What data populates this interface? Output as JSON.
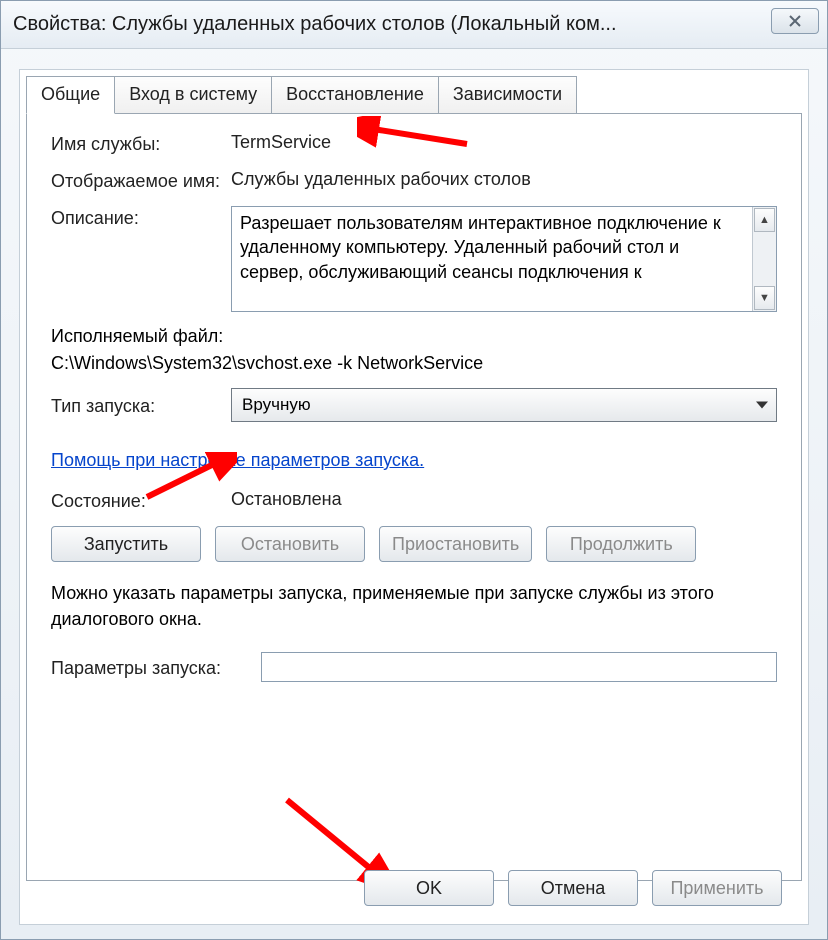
{
  "window": {
    "title": "Свойства: Службы удаленных рабочих столов (Локальный ком..."
  },
  "tabs": {
    "general": "Общие",
    "logon": "Вход в систему",
    "recovery": "Восстановление",
    "dependencies": "Зависимости"
  },
  "labels": {
    "service_name": "Имя службы:",
    "display_name": "Отображаемое имя:",
    "description": "Описание:",
    "executable": "Исполняемый файл:",
    "startup_type": "Тип запуска:",
    "status": "Состояние:",
    "start_params": "Параметры запуска:",
    "note": "Можно указать параметры запуска, применяемые при запуске службы из этого диалогового окна."
  },
  "values": {
    "service_name": "TermService",
    "display_name": "Службы удаленных рабочих столов",
    "description": "Разрешает пользователям интерактивное подключение к удаленному компьютеру. Удаленный рабочий стол и сервер, обслуживающий сеансы подключения к",
    "executable_path": "C:\\Windows\\System32\\svchost.exe -k NetworkService",
    "startup_type": "Вручную",
    "status": "Остановлена",
    "start_params": ""
  },
  "link": {
    "help": "Помощь при настройке параметров запуска."
  },
  "buttons": {
    "start": "Запустить",
    "stop": "Остановить",
    "pause": "Приостановить",
    "resume": "Продолжить",
    "ok": "OK",
    "cancel": "Отмена",
    "apply": "Применить"
  }
}
